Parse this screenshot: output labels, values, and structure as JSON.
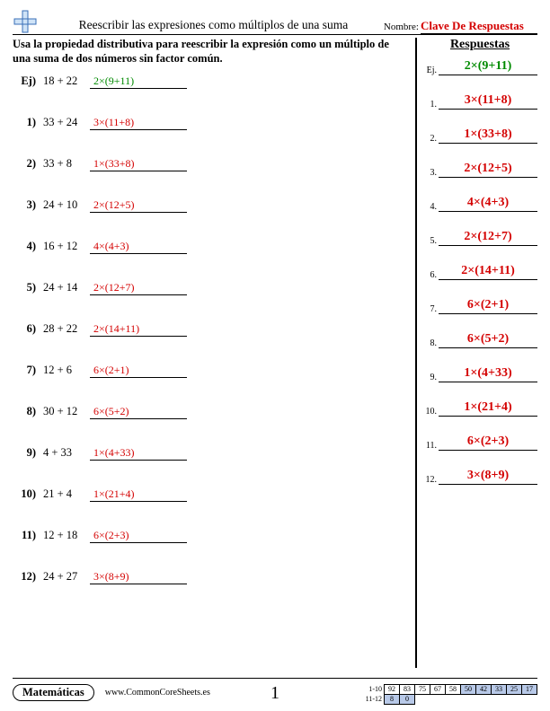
{
  "header": {
    "title": "Reescribir las expresiones como múltiplos de una suma",
    "name_label": "Nombre:",
    "name_value": "Clave De Respuestas"
  },
  "instructions": "Usa la propiedad distributiva para reescribir la expresión como un múltiplo de una suma de dos números sin factor común.",
  "example": {
    "label": "Ej)",
    "expr": "18 + 22",
    "answer": "2×(9+11)"
  },
  "problems": [
    {
      "n": "1)",
      "expr": "33 + 24",
      "answer": "3×(11+8)"
    },
    {
      "n": "2)",
      "expr": "33 + 8",
      "answer": "1×(33+8)"
    },
    {
      "n": "3)",
      "expr": "24 + 10",
      "answer": "2×(12+5)"
    },
    {
      "n": "4)",
      "expr": "16 + 12",
      "answer": "4×(4+3)"
    },
    {
      "n": "5)",
      "expr": "24 + 14",
      "answer": "2×(12+7)"
    },
    {
      "n": "6)",
      "expr": "28 + 22",
      "answer": "2×(14+11)"
    },
    {
      "n": "7)",
      "expr": "12 + 6",
      "answer": "6×(2+1)"
    },
    {
      "n": "8)",
      "expr": "30 + 12",
      "answer": "6×(5+2)"
    },
    {
      "n": "9)",
      "expr": "4 + 33",
      "answer": "1×(4+33)"
    },
    {
      "n": "10)",
      "expr": "21 + 4",
      "answer": "1×(21+4)"
    },
    {
      "n": "11)",
      "expr": "12 + 18",
      "answer": "6×(2+3)"
    },
    {
      "n": "12)",
      "expr": "24 + 27",
      "answer": "3×(8+9)"
    }
  ],
  "answers_panel": {
    "title": "Respuestas",
    "example_label": "Ej.",
    "items": [
      {
        "idx": "1.",
        "val": "3×(11+8)"
      },
      {
        "idx": "2.",
        "val": "1×(33+8)"
      },
      {
        "idx": "3.",
        "val": "2×(12+5)"
      },
      {
        "idx": "4.",
        "val": "4×(4+3)"
      },
      {
        "idx": "5.",
        "val": "2×(12+7)"
      },
      {
        "idx": "6.",
        "val": "2×(14+11)"
      },
      {
        "idx": "7.",
        "val": "6×(2+1)"
      },
      {
        "idx": "8.",
        "val": "6×(5+2)"
      },
      {
        "idx": "9.",
        "val": "1×(4+33)"
      },
      {
        "idx": "10.",
        "val": "1×(21+4)"
      },
      {
        "idx": "11.",
        "val": "6×(2+3)"
      },
      {
        "idx": "12.",
        "val": "3×(8+9)"
      }
    ],
    "example_val": "2×(9+11)"
  },
  "footer": {
    "subject": "Matemáticas",
    "website": "www.CommonCoreSheets.es",
    "page_number": "1",
    "score_rows": {
      "r1_label": "1-10",
      "r2_label": "11-12",
      "r1": [
        "92",
        "83",
        "75",
        "67",
        "58",
        "50",
        "42",
        "33",
        "25",
        "17"
      ],
      "r2": [
        "8",
        "0"
      ]
    }
  }
}
